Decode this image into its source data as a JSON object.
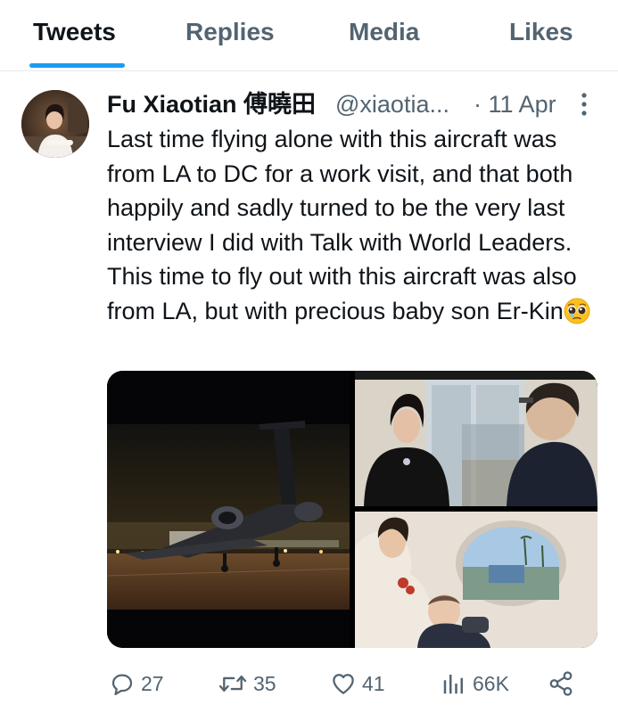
{
  "tabs": [
    {
      "label": "Tweets",
      "active": true
    },
    {
      "label": "Replies",
      "active": false
    },
    {
      "label": "Media",
      "active": false
    },
    {
      "label": "Likes",
      "active": false
    }
  ],
  "tweet": {
    "author_name": "Fu Xiaotian 傅曉田",
    "author_handle": "@xiaotia...",
    "date_sep": "·",
    "date": "11 Apr",
    "text": "Last time flying alone with this aircraft was from LA to DC for a work visit, and that both happily and sadly turned to be the very last interview I did with Talk with World Leaders. This time to fly out with this aircraft was also from LA, but with precious baby son Er-Kin",
    "emoji": "pleading-face-emoji",
    "media": [
      {
        "name": "private-jet-night-photo"
      },
      {
        "name": "interview-portrait-photo"
      },
      {
        "name": "mother-baby-in-aircraft-photo"
      }
    ]
  },
  "actions": {
    "reply_count": "27",
    "retweet_count": "35",
    "like_count": "41",
    "views_count": "66K"
  },
  "icons": {
    "reply": "reply-icon",
    "retweet": "retweet-icon",
    "like": "heart-icon",
    "views": "views-chart-icon",
    "share": "share-icon",
    "more": "more-dots-icon"
  },
  "colors": {
    "accent": "#1d9bf0",
    "text_primary": "#0f1419",
    "text_secondary": "#536471",
    "divider": "#e6e9eb"
  }
}
